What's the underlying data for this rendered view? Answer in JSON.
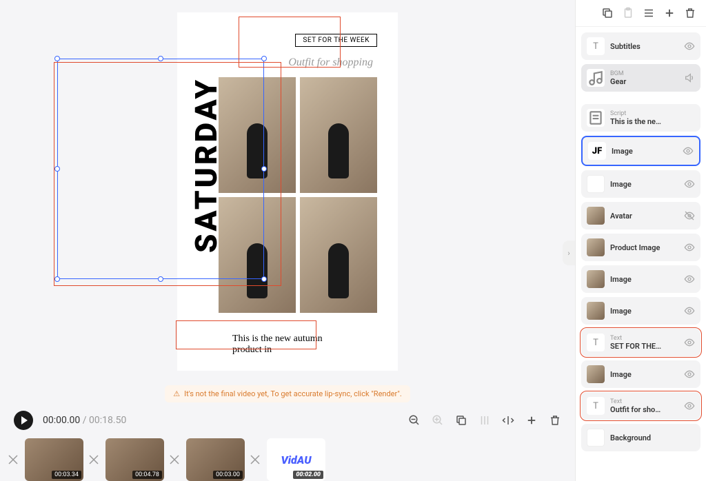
{
  "canvas": {
    "week_label": "SET FOR THE WEEK",
    "script_label": "Outfit for shopping",
    "day_text": "SATURDAY",
    "caption": "This is the new autumn product in"
  },
  "warning": "It's not the final video yet, To get accurate lip-sync, click \"Render\".",
  "timeline": {
    "current": "00:00.00",
    "duration": "00:18.50",
    "thumbs": [
      {
        "dur": "00:03.34"
      },
      {
        "dur": "00:04.78"
      },
      {
        "dur": "00:03.00"
      },
      {
        "dur": "00:02.00",
        "logo": "VidAU"
      }
    ]
  },
  "layers": [
    {
      "type": "text",
      "name": "Subtitles",
      "icon": "T",
      "vis": true
    },
    {
      "type": "bgm",
      "sub": "BGM",
      "name": "Gear",
      "icon": "music",
      "vis": true,
      "bgm": true
    },
    {
      "type": "script",
      "sub": "Script",
      "name": "This is the ne…",
      "icon": "script",
      "vis": null
    },
    {
      "type": "image",
      "name": "Image",
      "icon": "jf",
      "vis": true,
      "selected": true
    },
    {
      "type": "image",
      "name": "Image",
      "icon": "white",
      "vis": true
    },
    {
      "type": "avatar",
      "name": "Avatar",
      "icon": "img",
      "vis": false
    },
    {
      "type": "image",
      "name": "Product Image",
      "icon": "img",
      "vis": true
    },
    {
      "type": "image",
      "name": "Image",
      "icon": "img",
      "vis": true
    },
    {
      "type": "image",
      "name": "Image",
      "icon": "img",
      "vis": true
    },
    {
      "type": "text",
      "sub": "Text",
      "name": "SET FOR THE…",
      "icon": "T",
      "vis": true,
      "hl": true
    },
    {
      "type": "image",
      "name": "Image",
      "icon": "img",
      "vis": true
    },
    {
      "type": "text",
      "sub": "Text",
      "name": "Outfit for sho…",
      "icon": "T",
      "vis": true,
      "hl": true
    },
    {
      "type": "bg",
      "name": "Background",
      "icon": "white",
      "vis": null
    }
  ]
}
